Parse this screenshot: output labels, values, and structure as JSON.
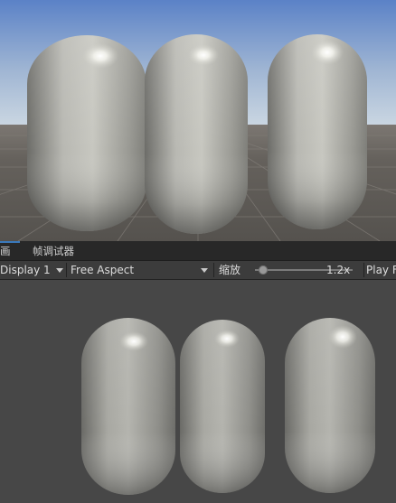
{
  "tabs": [
    {
      "label": "画",
      "active": true
    },
    {
      "label": "帧调试器",
      "active": false
    }
  ],
  "toolbar": {
    "display": "Display 1",
    "aspect": "Free Aspect",
    "scale_label": "缩放",
    "scale_value": "1.2x",
    "scale_fraction": 0.08,
    "play_mode": "Play F"
  },
  "colors": {
    "sky_top": "#5b82c7",
    "horizon": "#c9d6e3",
    "ground": "#5d5954",
    "game_background": "#474747",
    "tab_accent": "#3a79bb"
  },
  "icons": [
    "dropdown-arrow-icon",
    "slider-thumb-icon"
  ]
}
